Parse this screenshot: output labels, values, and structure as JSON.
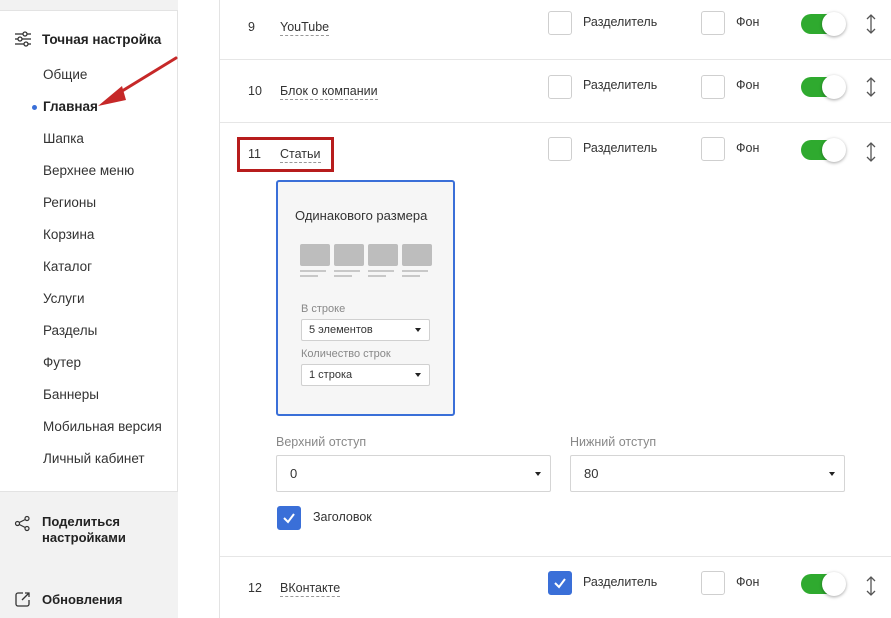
{
  "sidebar": {
    "section_title": "Точная настройка",
    "items": [
      {
        "label": "Общие"
      },
      {
        "label": "Главная",
        "active": true
      },
      {
        "label": "Шапка"
      },
      {
        "label": "Верхнее меню"
      },
      {
        "label": "Регионы"
      },
      {
        "label": "Корзина"
      },
      {
        "label": "Каталог"
      },
      {
        "label": "Услуги"
      },
      {
        "label": "Разделы"
      },
      {
        "label": "Футер"
      },
      {
        "label": "Баннеры"
      },
      {
        "label": "Мобильная версия"
      },
      {
        "label": "Личный кабинет"
      }
    ],
    "share_label": "Поделиться настройками",
    "updates_label": "Обновления"
  },
  "rows": [
    {
      "num": "9",
      "name": "YouTube",
      "separator_label": "Разделитель",
      "separator_checked": false,
      "bg_label": "Фон",
      "bg_checked": false,
      "enabled": true
    },
    {
      "num": "10",
      "name": "Блок о компании",
      "separator_label": "Разделитель",
      "separator_checked": false,
      "bg_label": "Фон",
      "bg_checked": false,
      "enabled": true
    },
    {
      "num": "11",
      "name": "Статьи",
      "separator_label": "Разделитель",
      "separator_checked": false,
      "bg_label": "Фон",
      "bg_checked": false,
      "enabled": true
    },
    {
      "num": "12",
      "name": "ВКонтакте",
      "separator_label": "Разделитель",
      "separator_checked": true,
      "bg_label": "Фон",
      "bg_checked": false,
      "enabled": true
    }
  ],
  "articles_settings": {
    "card_title": "Одинакового размера",
    "per_row_label": "В строке",
    "per_row_value": "5 элементов",
    "rows_count_label": "Количество строк",
    "rows_count_value": "1 строка",
    "top_padding_label": "Верхний отступ",
    "top_padding_value": "0",
    "bottom_padding_label": "Нижний отступ",
    "bottom_padding_value": "80",
    "heading_label": "Заголовок",
    "heading_checked": true
  },
  "colors": {
    "accent": "#3a6fd8",
    "toggle_on": "#2faa2f",
    "highlight": "#b71c1c"
  },
  "icons": {
    "section": "sliders-icon",
    "share": "share-icon",
    "updates": "update-icon",
    "drag": "drag-vertical-icon",
    "check": "checkmark-icon"
  }
}
